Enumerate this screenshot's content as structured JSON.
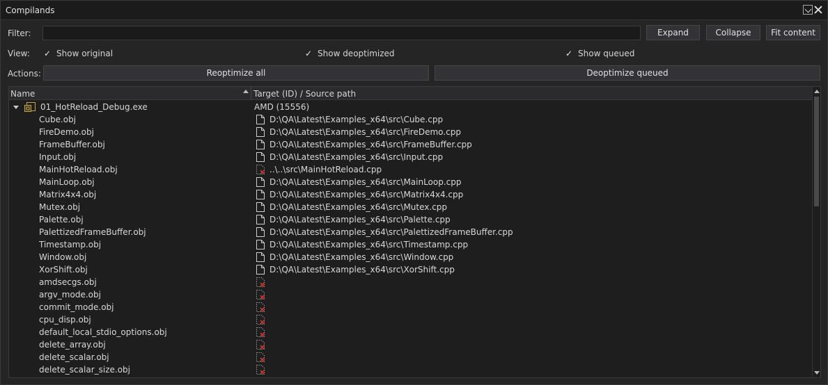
{
  "window": {
    "title": "Compilands"
  },
  "filter": {
    "label": "Filter:",
    "value": "",
    "placeholder": ""
  },
  "buttons": {
    "expand": "Expand",
    "collapse": "Collapse",
    "fit": "Fit content",
    "reoptimize": "Reoptimize all",
    "deoptimize": "Deoptimize queued"
  },
  "view": {
    "label": "View:",
    "show_original": {
      "label": "Show original",
      "checked": true
    },
    "show_deoptimized": {
      "label": "Show deoptimized",
      "checked": true
    },
    "show_queued": {
      "label": "Show queued",
      "checked": true
    }
  },
  "actions": {
    "label": "Actions:"
  },
  "table": {
    "columns": [
      "Name",
      "Target (ID) / Source path"
    ],
    "root": {
      "name": "01_HotReload_Debug.exe",
      "target": "AMD (15556)",
      "icon": "executable-icon",
      "expanded": true
    },
    "rows": [
      {
        "name": "Cube.obj",
        "path": "D:\\QA\\Latest\\Examples_x64\\src\\Cube.cpp",
        "icon": "file-icon"
      },
      {
        "name": "FireDemo.obj",
        "path": "D:\\QA\\Latest\\Examples_x64\\src\\FireDemo.cpp",
        "icon": "file-icon"
      },
      {
        "name": "FrameBuffer.obj",
        "path": "D:\\QA\\Latest\\Examples_x64\\src\\FrameBuffer.cpp",
        "icon": "file-icon"
      },
      {
        "name": "Input.obj",
        "path": "D:\\QA\\Latest\\Examples_x64\\src\\Input.cpp",
        "icon": "file-icon"
      },
      {
        "name": "MainHotReload.obj",
        "path": "..\\..\\src\\MainHotReload.cpp",
        "icon": "missing-file-icon"
      },
      {
        "name": "MainLoop.obj",
        "path": "D:\\QA\\Latest\\Examples_x64\\src\\MainLoop.cpp",
        "icon": "file-icon"
      },
      {
        "name": "Matrix4x4.obj",
        "path": "D:\\QA\\Latest\\Examples_x64\\src\\Matrix4x4.cpp",
        "icon": "file-icon"
      },
      {
        "name": "Mutex.obj",
        "path": "D:\\QA\\Latest\\Examples_x64\\src\\Mutex.cpp",
        "icon": "file-icon"
      },
      {
        "name": "Palette.obj",
        "path": "D:\\QA\\Latest\\Examples_x64\\src\\Palette.cpp",
        "icon": "file-icon"
      },
      {
        "name": "PalettizedFrameBuffer.obj",
        "path": "D:\\QA\\Latest\\Examples_x64\\src\\PalettizedFrameBuffer.cpp",
        "icon": "file-icon"
      },
      {
        "name": "Timestamp.obj",
        "path": "D:\\QA\\Latest\\Examples_x64\\src\\Timestamp.cpp",
        "icon": "file-icon"
      },
      {
        "name": "Window.obj",
        "path": "D:\\QA\\Latest\\Examples_x64\\src\\Window.cpp",
        "icon": "file-icon"
      },
      {
        "name": "XorShift.obj",
        "path": "D:\\QA\\Latest\\Examples_x64\\src\\XorShift.cpp",
        "icon": "file-icon"
      },
      {
        "name": "amdsecgs.obj",
        "path": "",
        "icon": "missing-file-icon"
      },
      {
        "name": "argv_mode.obj",
        "path": "",
        "icon": "missing-file-icon"
      },
      {
        "name": "commit_mode.obj",
        "path": "",
        "icon": "missing-file-icon"
      },
      {
        "name": "cpu_disp.obj",
        "path": "",
        "icon": "missing-file-icon"
      },
      {
        "name": "default_local_stdio_options.obj",
        "path": "",
        "icon": "missing-file-icon"
      },
      {
        "name": "delete_array.obj",
        "path": "",
        "icon": "missing-file-icon"
      },
      {
        "name": "delete_scalar.obj",
        "path": "",
        "icon": "missing-file-icon"
      },
      {
        "name": "delete_scalar_size.obj",
        "path": "",
        "icon": "missing-file-icon"
      }
    ]
  },
  "colors": {
    "background": "#1e1e1e",
    "panel": "#252526",
    "missing_mark": "#d03030"
  }
}
